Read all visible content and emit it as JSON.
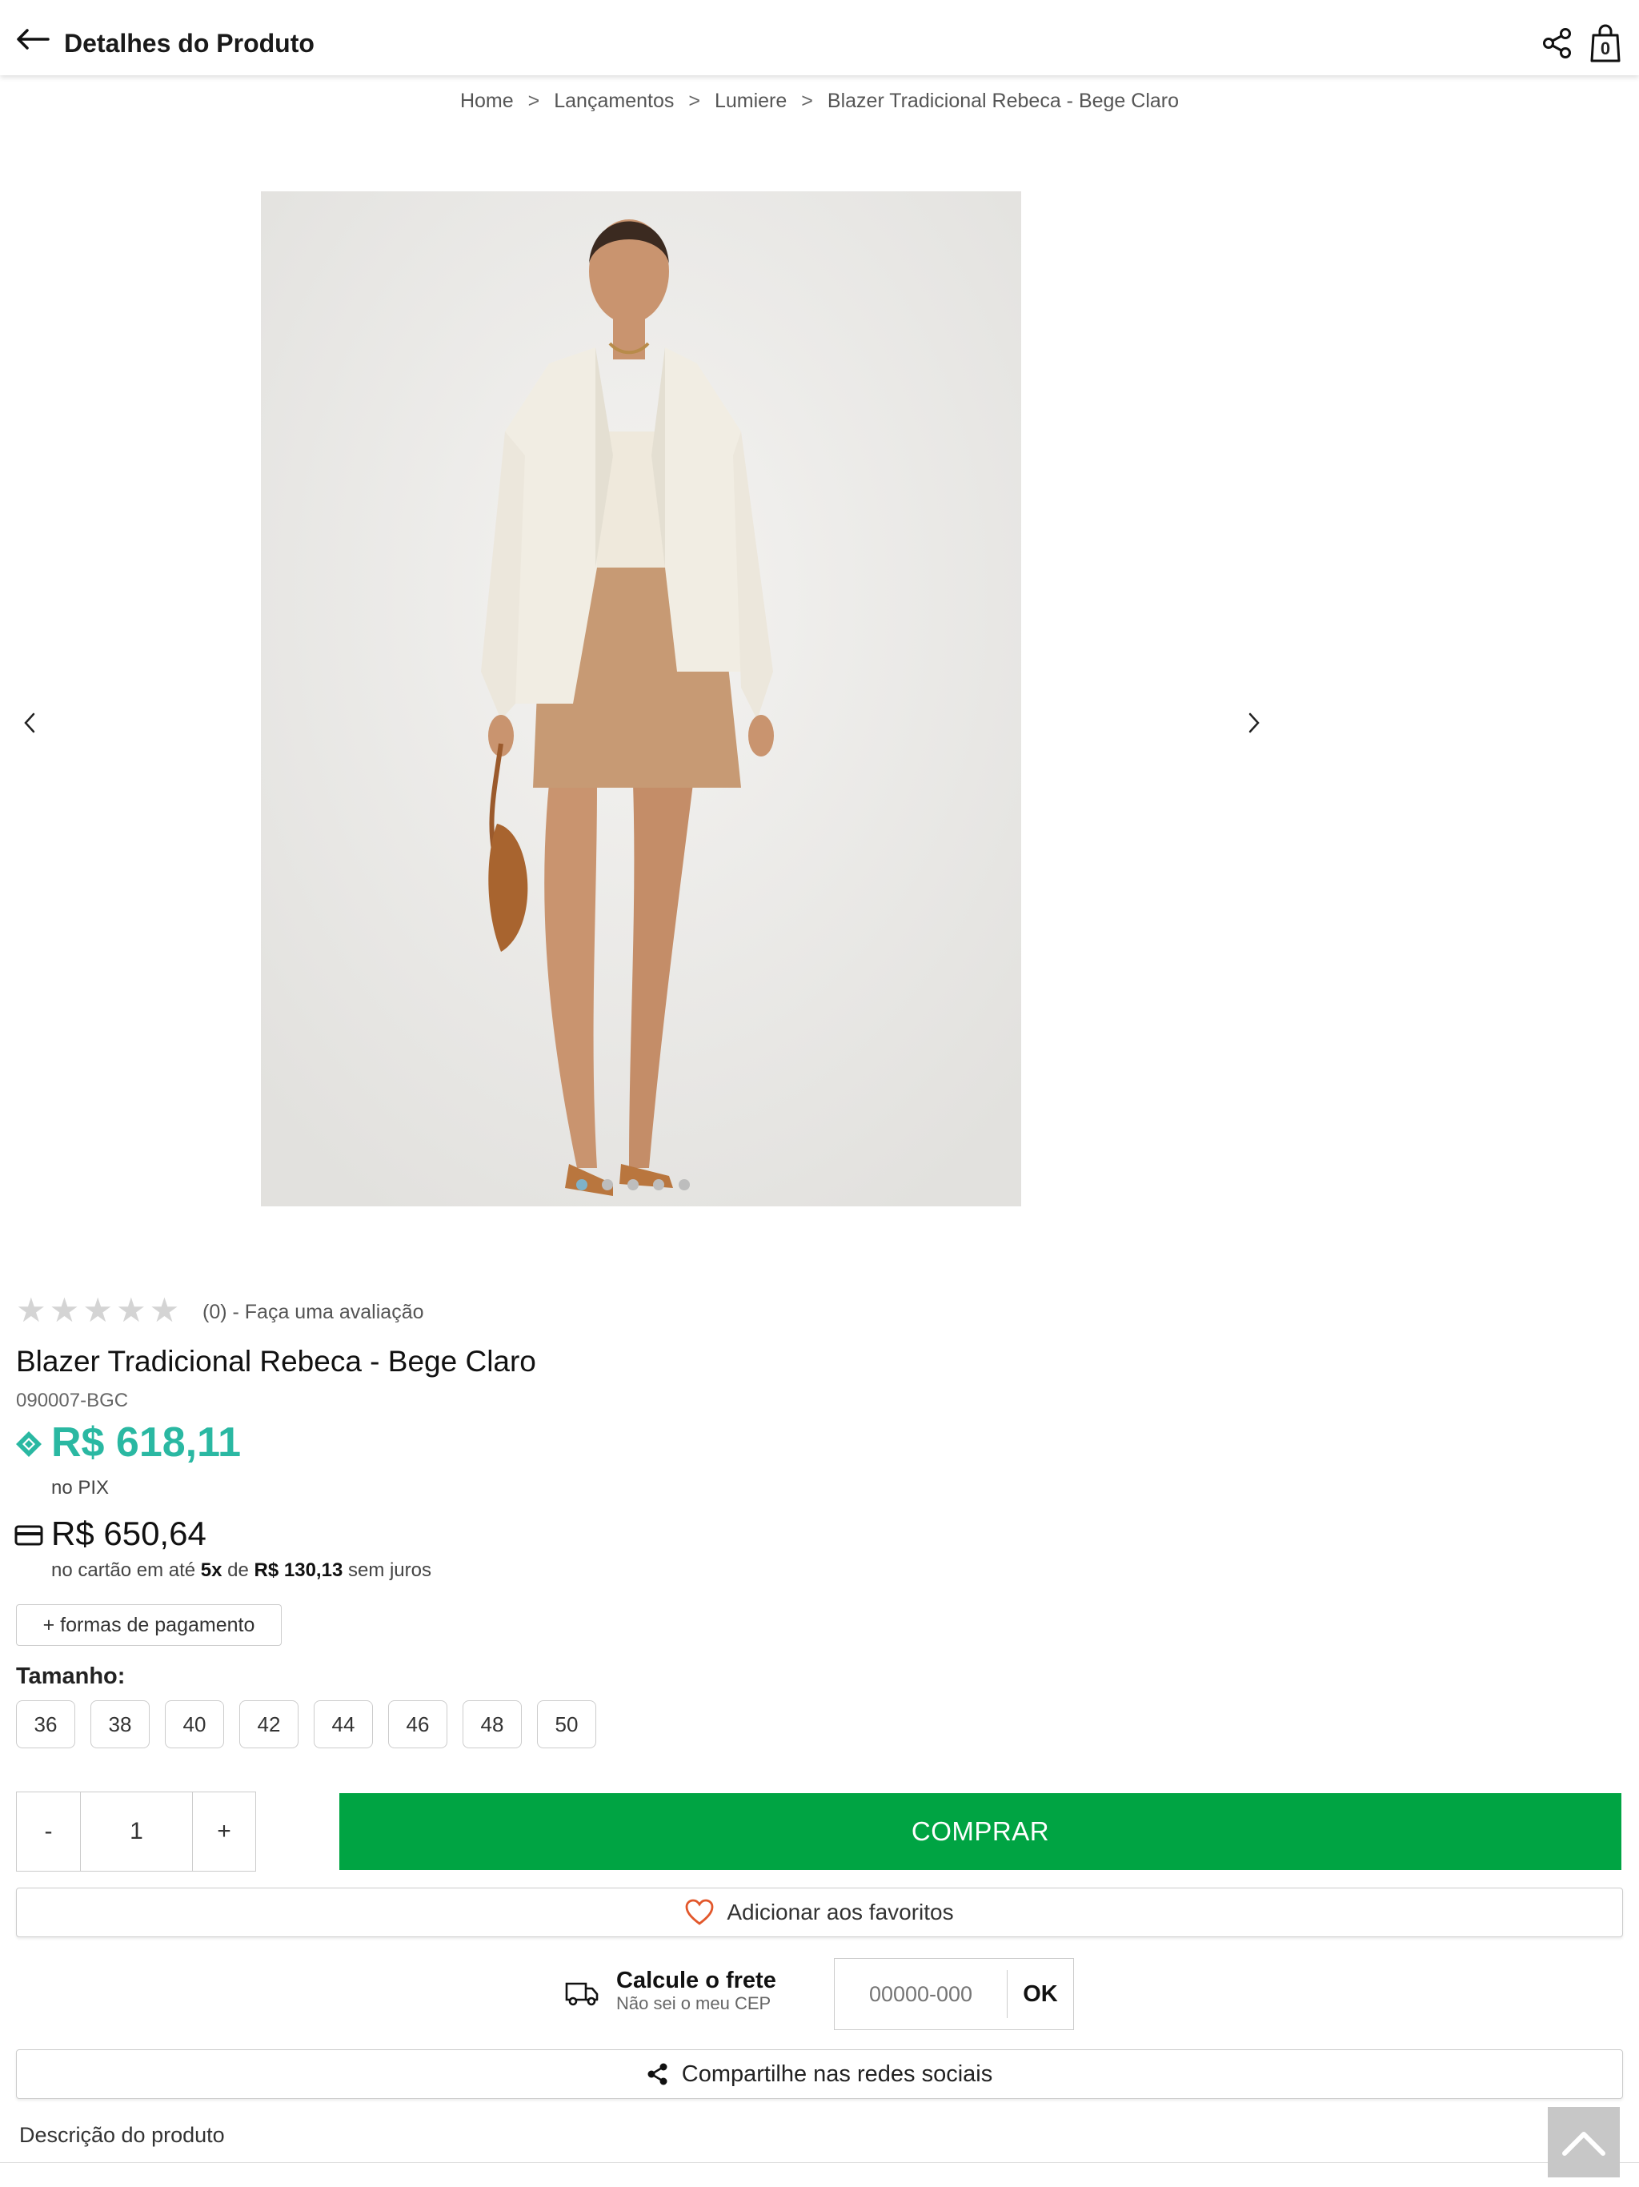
{
  "header": {
    "title": "Detalhes do Produto",
    "bag_count": "0"
  },
  "breadcrumb": {
    "items": [
      "Home",
      "Lançamentos",
      "Lumiere",
      "Blazer Tradicional Rebeca - Bege Claro"
    ],
    "separator": ">"
  },
  "gallery": {
    "image_count": 5,
    "active_index": 0,
    "image_alt_icon": "product-photo"
  },
  "rating": {
    "stars": 5,
    "filled": 0,
    "text": "(0) - Faça uma avaliação"
  },
  "product": {
    "name": "Blazer Tradicional Rebeca - Bege Claro",
    "sku": "090007-BGC"
  },
  "price": {
    "pix_value": "R$ 618,11",
    "pix_label": "no PIX",
    "card_value": "R$ 650,64",
    "card_terms_prefix": "no cartão em até",
    "installments": "5x",
    "card_terms_mid": "de",
    "installment_value": "R$ 130,13",
    "card_terms_suffix": "sem juros",
    "payment_methods_label": "+ formas de pagamento",
    "pix_color": "#2ab8a2"
  },
  "sizes": {
    "label": "Tamanho:",
    "options": [
      "36",
      "38",
      "40",
      "42",
      "44",
      "46",
      "48",
      "50"
    ]
  },
  "quantity": {
    "minus": "-",
    "value": "1",
    "plus": "+"
  },
  "actions": {
    "buy_label": "COMPRAR",
    "buy_color": "#00a443",
    "favorite_label": "Adicionar aos favoritos",
    "share_label": "Compartilhe nas redes sociais"
  },
  "shipping": {
    "title": "Calcule o frete",
    "subtitle": "Não sei o meu CEP",
    "cep_placeholder": "00000-000",
    "ok_label": "OK"
  },
  "description": {
    "label": "Descrição do produto"
  }
}
